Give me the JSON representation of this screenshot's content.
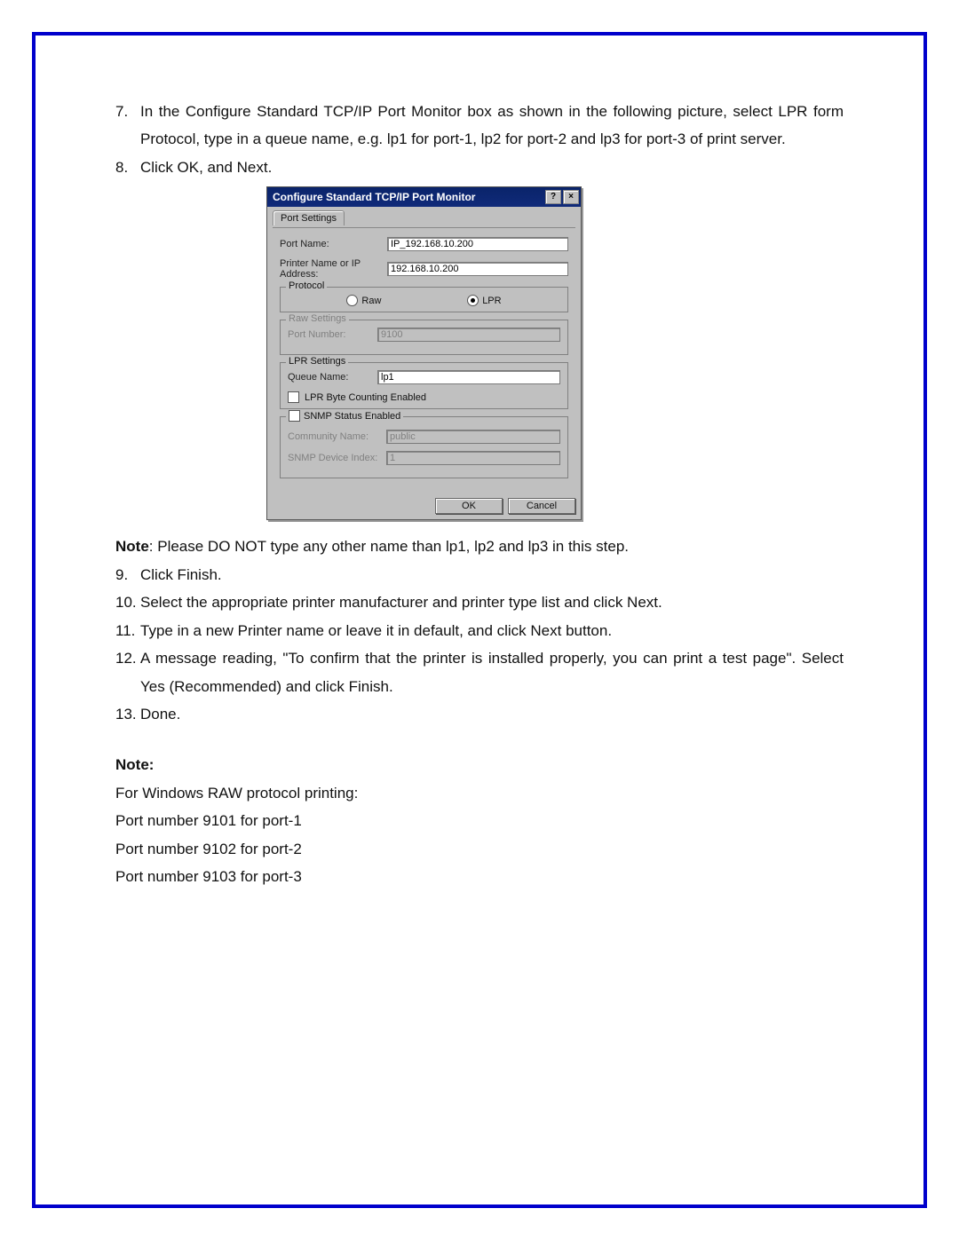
{
  "steps": {
    "s7_num": "7.",
    "s7_text": "In the Configure Standard TCP/IP Port Monitor box as shown in the following picture, select LPR form Protocol, type in a queue name, e.g. lp1 for port-1, lp2 for port-2 and lp3 for port-3 of print server.",
    "s8_num": "8.",
    "s8_text": "Click OK, and Next.",
    "note_label1": "Note",
    "note1": ": Please DO NOT type any other name than lp1, lp2 and lp3 in this step.",
    "s9_num": "9.",
    "s9_text": "Click Finish.",
    "s10_num": "10.",
    "s10_text": "Select the appropriate printer manufacturer and printer type list and click Next.",
    "s11_num": "11.",
    "s11_text": "Type in a new Printer name or leave it in default, and click Next button.",
    "s12_num": "12.",
    "s12_text": "A message reading, \"To confirm that the printer is installed properly, you can print a test page\". Select Yes (Recommended) and click Finish.",
    "s13_num": "13.",
    "s13_text": "Done.",
    "note_label2": "Note:",
    "raw_intro": "For Windows RAW protocol printing:",
    "raw_p1": "Port number 9101 for port-1",
    "raw_p2": "Port number 9102 for port-2",
    "raw_p3": "Port number 9103 for port-3"
  },
  "dialog": {
    "title": "Configure Standard TCP/IP Port Monitor",
    "tab_label": "Port Settings",
    "port_name_label": "Port Name:",
    "port_name_value": "IP_192.168.10.200",
    "ip_label": "Printer Name or IP Address:",
    "ip_value": "192.168.10.200",
    "protocol_legend": "Protocol",
    "raw_label": "Raw",
    "lpr_label": "LPR",
    "raw_settings_legend": "Raw Settings",
    "port_number_label": "Port Number:",
    "port_number_value": "9100",
    "lpr_settings_legend": "LPR Settings",
    "queue_name_label": "Queue Name:",
    "queue_name_value": "lp1",
    "lpr_byte_label": "LPR Byte Counting Enabled",
    "snmp_legend": "SNMP Status Enabled",
    "community_label": "Community Name:",
    "community_value": "public",
    "device_index_label": "SNMP Device Index:",
    "device_index_value": "1",
    "ok": "OK",
    "cancel": "Cancel"
  }
}
